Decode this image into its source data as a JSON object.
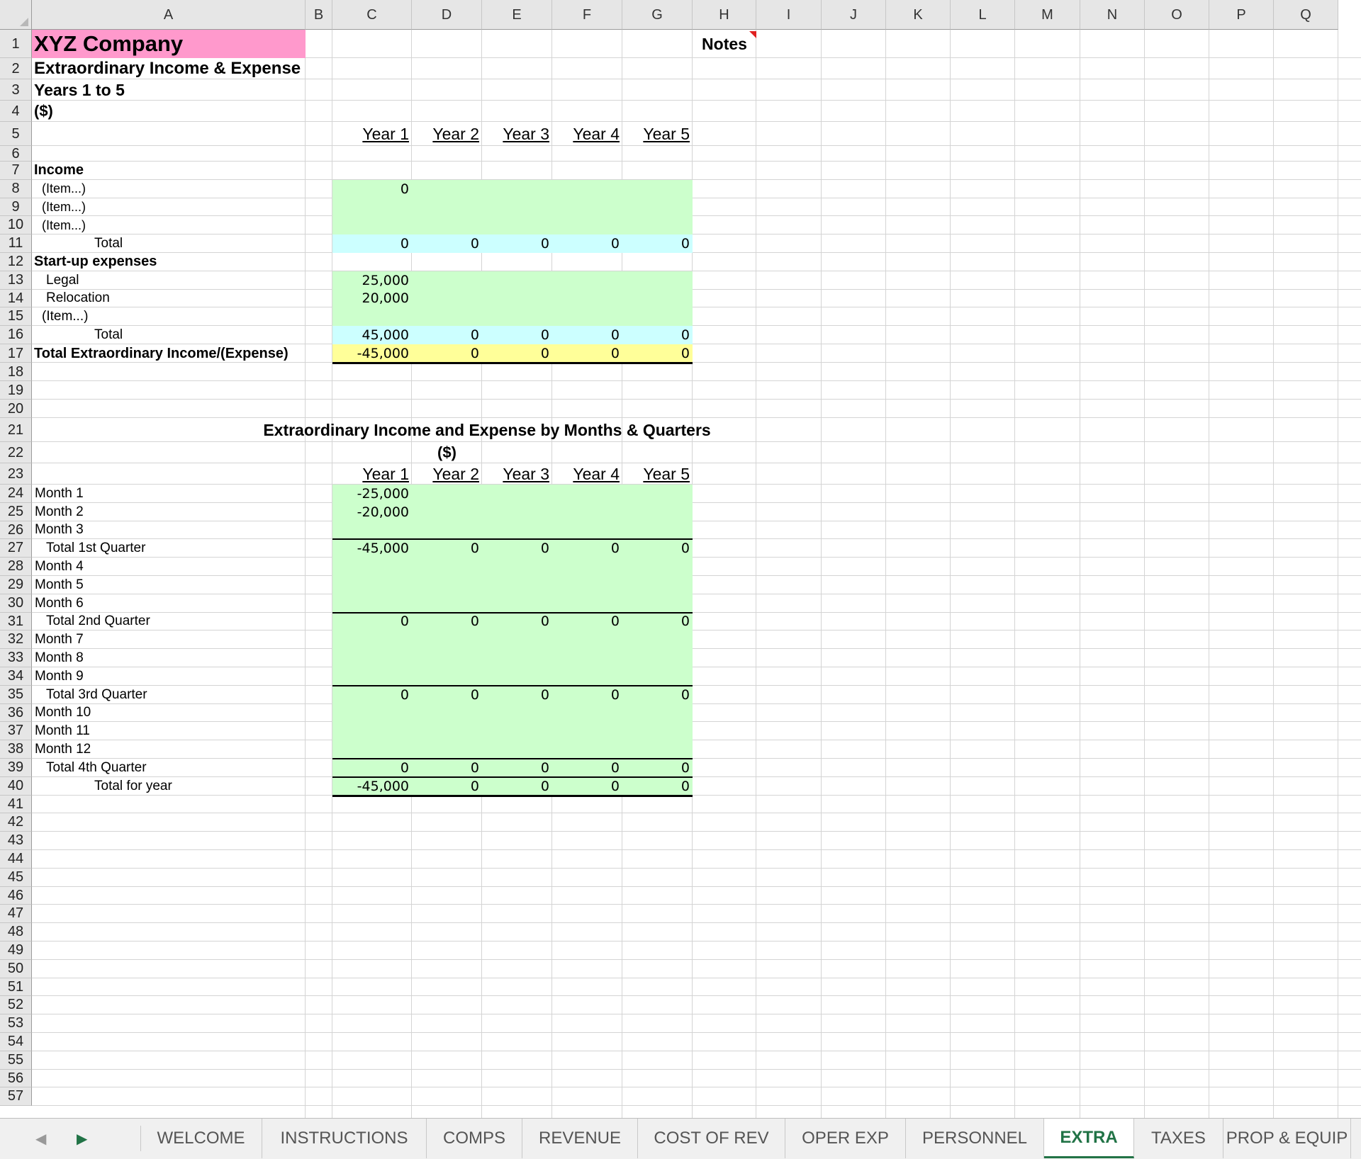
{
  "columns": [
    "A",
    "B",
    "C",
    "D",
    "E",
    "F",
    "G",
    "H",
    "I",
    "J",
    "K",
    "L",
    "M",
    "N",
    "O",
    "P",
    "Q"
  ],
  "rows": [
    1,
    2,
    3,
    4,
    5,
    6,
    7,
    8,
    9,
    10,
    11,
    12,
    13,
    14,
    15,
    16,
    17,
    18,
    19,
    20,
    21,
    22,
    23,
    24,
    25,
    26,
    27,
    28,
    29,
    30,
    31,
    32,
    33,
    34,
    35,
    36,
    37,
    38,
    39,
    40,
    41,
    42,
    43,
    44,
    45,
    46,
    47,
    48,
    49,
    50,
    51,
    52,
    53,
    54,
    55,
    56,
    57
  ],
  "header": {
    "company": "XYZ Company",
    "subtitle": "Extraordinary Income & Expense",
    "years_range": "Years 1 to 5",
    "units": "($)",
    "notes": "Notes"
  },
  "year_labels": [
    "Year 1",
    "Year 2",
    "Year 3",
    "Year 4",
    "Year 5"
  ],
  "income": {
    "heading": "Income",
    "items": [
      {
        "label": "(Item...)",
        "values": [
          "0",
          "",
          "",
          "",
          ""
        ]
      },
      {
        "label": "(Item...)",
        "values": [
          "",
          "",
          "",
          "",
          ""
        ]
      },
      {
        "label": "(Item...)",
        "values": [
          "",
          "",
          "",
          "",
          ""
        ]
      }
    ],
    "total": {
      "label": "Total",
      "values": [
        "0",
        "0",
        "0",
        "0",
        "0"
      ]
    }
  },
  "startup": {
    "heading": "Start-up expenses",
    "items": [
      {
        "label": "Legal",
        "values": [
          "25,000",
          "",
          "",
          "",
          ""
        ]
      },
      {
        "label": "Relocation",
        "values": [
          "20,000",
          "",
          "",
          "",
          ""
        ]
      },
      {
        "label": "(Item...)",
        "values": [
          "",
          "",
          "",
          "",
          ""
        ]
      }
    ],
    "total": {
      "label": "Total",
      "values": [
        "45,000",
        "0",
        "0",
        "0",
        "0"
      ]
    }
  },
  "grand_total": {
    "label": "Total Extraordinary Income/(Expense)",
    "values": [
      "-45,000",
      "0",
      "0",
      "0",
      "0"
    ]
  },
  "section2": {
    "title": "Extraordinary Income and Expense by Months & Quarters",
    "units": "($)",
    "rows": [
      {
        "label": "Month 1",
        "values": [
          "-25,000",
          "",
          "",
          "",
          ""
        ]
      },
      {
        "label": "Month 2",
        "values": [
          "-20,000",
          "",
          "",
          "",
          ""
        ]
      },
      {
        "label": "Month 3",
        "values": [
          "",
          "",
          "",
          "",
          ""
        ]
      },
      {
        "label": "Total 1st Quarter",
        "values": [
          "-45,000",
          "0",
          "0",
          "0",
          "0"
        ]
      },
      {
        "label": "Month 4",
        "values": [
          "",
          "",
          "",
          "",
          ""
        ]
      },
      {
        "label": "Month 5",
        "values": [
          "",
          "",
          "",
          "",
          ""
        ]
      },
      {
        "label": "Month 6",
        "values": [
          "",
          "",
          "",
          "",
          ""
        ]
      },
      {
        "label": "Total 2nd Quarter",
        "values": [
          "0",
          "0",
          "0",
          "0",
          "0"
        ]
      },
      {
        "label": "Month 7",
        "values": [
          "",
          "",
          "",
          "",
          ""
        ]
      },
      {
        "label": "Month 8",
        "values": [
          "",
          "",
          "",
          "",
          ""
        ]
      },
      {
        "label": "Month 9",
        "values": [
          "",
          "",
          "",
          "",
          ""
        ]
      },
      {
        "label": "Total 3rd Quarter",
        "values": [
          "0",
          "0",
          "0",
          "0",
          "0"
        ]
      },
      {
        "label": "Month 10",
        "values": [
          "",
          "",
          "",
          "",
          ""
        ]
      },
      {
        "label": "Month 11",
        "values": [
          "",
          "",
          "",
          "",
          ""
        ]
      },
      {
        "label": "Month 12",
        "values": [
          "",
          "",
          "",
          "",
          ""
        ]
      },
      {
        "label": "Total 4th Quarter",
        "values": [
          "0",
          "0",
          "0",
          "0",
          "0"
        ]
      },
      {
        "label": "Total for year",
        "values": [
          "-45,000",
          "0",
          "0",
          "0",
          "0"
        ]
      }
    ]
  },
  "tabs": [
    "WELCOME",
    "INSTRUCTIONS",
    "COMPS",
    "REVENUE",
    "COST OF REV",
    "OPER EXP",
    "PERSONNEL",
    "EXTRA",
    "TAXES",
    "PROP & EQUIP"
  ],
  "active_tab": "EXTRA",
  "colors": {
    "title_fill": "#ff99cc",
    "input_fill": "#ccffcc",
    "total_fill": "#ccffff",
    "grand_fill": "#ffff99",
    "active_tab": "#217346",
    "note_marker": "#e02020"
  }
}
